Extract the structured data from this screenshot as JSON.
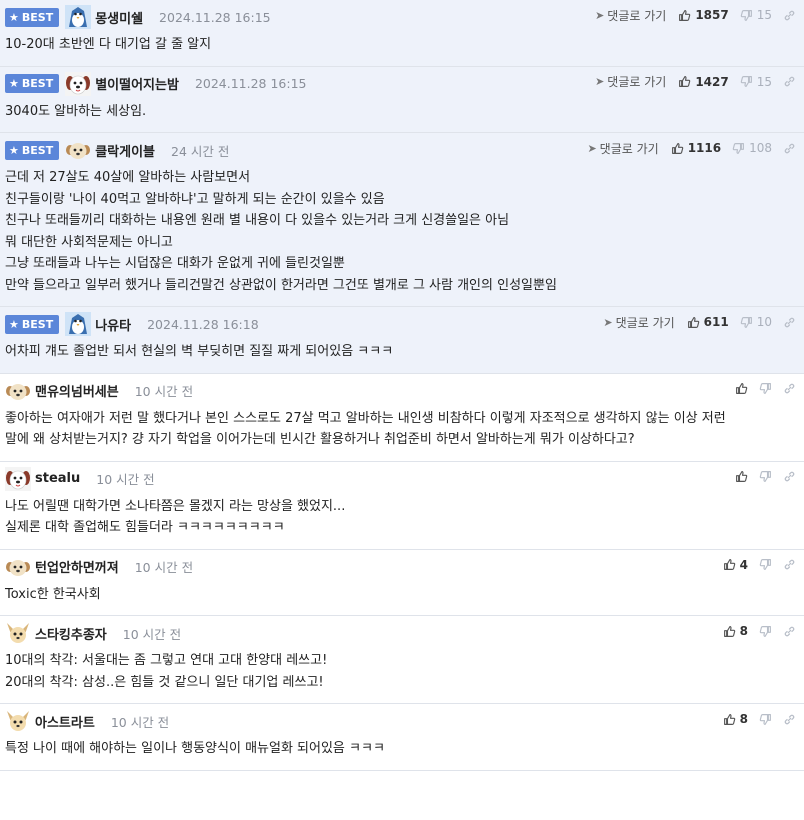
{
  "reply_label": "댓글로 가기",
  "best_label": "BEST",
  "comments": [
    {
      "best": true,
      "avatar": "penguin",
      "nick": "몽생미쉘",
      "date": "2024.11.28 16:15",
      "likes": "1857",
      "dislikes": "15",
      "lines": [
        "10-20대 초반엔 다 대기업 갈 줄 알지"
      ]
    },
    {
      "best": true,
      "avatar": "dog-white",
      "nick": "별이떨어지는밤",
      "date": "2024.11.28 16:15",
      "likes": "1427",
      "dislikes": "15",
      "lines": [
        "3040도 알바하는 세상임."
      ]
    },
    {
      "best": true,
      "avatar": "puppy",
      "nick": "클락게이블",
      "date": "24 시간 전",
      "likes": "1116",
      "dislikes": "108",
      "lines": [
        "근데 저 27살도 40살에 알바하는 사람보면서",
        "친구들이랑 '나이 40먹고 알바하냐'고 말하게 되는 순간이 있을수 있음",
        "친구나 또래들끼리 대화하는 내용엔 원래 별 내용이 다 있을수 있는거라 크게 신경쓸일은 아님",
        "뭐 대단한 사회적문제는 아니고",
        "그냥 또래들과 나누는 시덥잖은 대화가 운없게 귀에 들린것일뿐",
        "만약 들으라고 일부러 했거나 들리건말건 상관없이 한거라면 그건또 별개로 그 사람 개인의 인성일뿐임"
      ]
    },
    {
      "best": true,
      "avatar": "penguin",
      "nick": "나유타",
      "date": "2024.11.28 16:18",
      "likes": "611",
      "dislikes": "10",
      "lines": [
        "어차피 걔도 졸업반 되서 현실의 벽 부딪히면 질질 짜게 되어있음 ㅋㅋㅋ"
      ]
    },
    {
      "best": false,
      "avatar": "puppy-small",
      "nick": "맨유의넘버세븐",
      "date": "10 시간 전",
      "likes": "",
      "dislikes": "",
      "lines": [
        "좋아하는 여자애가 저런 말 했다거나 본인 스스로도 27살 먹고 알바하는 내인생 비참하다 이렇게 자조적으로 생각하지 않는 이상 저런",
        "말에 왜 상처받는거지? 걍 자기 학업을 이어가는데 빈시간 활용하거나 취업준비 하면서 알바하는게 뭐가 이상하다고?"
      ]
    },
    {
      "best": false,
      "avatar": "dog-white",
      "nick": "stealu",
      "date": "10 시간 전",
      "likes": "",
      "dislikes": "",
      "lines": [
        "나도 어릴땐 대학가면 소나타쯤은 몰겠지 라는 망상을 했었지...",
        "실제론 대학 졸업해도 힘들더라 ㅋㅋㅋㅋㅋㅋㅋㅋㅋ"
      ]
    },
    {
      "best": false,
      "avatar": "puppy",
      "nick": "턴업안하면꺼져",
      "date": "10 시간 전",
      "likes": "4",
      "dislikes": "",
      "lines": [
        "Toxic한 한국사회"
      ]
    },
    {
      "best": false,
      "avatar": "chihuahua",
      "nick": "스타킹추종자",
      "date": "10 시간 전",
      "likes": "8",
      "dislikes": "",
      "lines": [
        "10대의 착각: 서울대는 좀 그렇고 연대 고대 한양대 레쓰고!",
        "20대의 착각: 삼성..은 힘들 것 같으니 일단 대기업 레쓰고!"
      ]
    },
    {
      "best": false,
      "avatar": "chihuahua",
      "nick": "아스트라트",
      "date": "10 시간 전",
      "likes": "8",
      "dislikes": "",
      "lines": [
        "특정 나이 때에 해야하는 일이나 행동양식이 매뉴얼화 되어있음 ㅋㅋㅋ"
      ]
    }
  ]
}
